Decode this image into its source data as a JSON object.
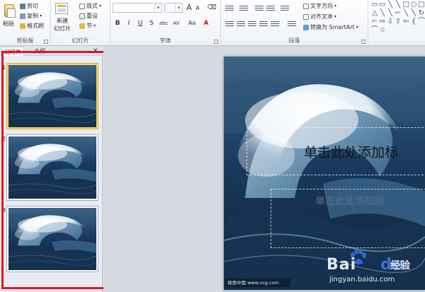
{
  "ribbon": {
    "clipboard": {
      "paste_label": "粘贴",
      "cut_label": "剪切",
      "copy_label": "复制",
      "format_painter_label": "格式刷",
      "group_label": "剪贴板"
    },
    "slides": {
      "new_slide_label_line1": "新建",
      "new_slide_label_line2": "幻灯片",
      "layout_label": "版式",
      "reset_label": "重设",
      "section_label": "节",
      "group_label": "幻灯片"
    },
    "font": {
      "grow_label": "A",
      "shrink_label": "A",
      "bold": "B",
      "italic": "I",
      "underline": "U",
      "strike": "S",
      "shadow": "abc",
      "spacing": "AV",
      "case": "Aa",
      "color": "A",
      "group_label": "字体"
    },
    "paragraph": {
      "text_direction_label": "文字方向",
      "align_text_label": "对齐文本",
      "smartart_label": "转换为 SmartArt",
      "group_label": "段落"
    },
    "drawing": {
      "shape_glyphs": [
        "▭",
        "▭",
        "╲",
        "╲",
        "□",
        "○",
        "□",
        "△",
        "╲",
        "╲",
        "⌐",
        "╲",
        "╲",
        "↻",
        "⌐",
        "⇨",
        "⇩",
        "⇧",
        "⇦",
        "{",
        "⌒",
        "⌒",
        "☆"
      ]
    }
  },
  "left_pane": {
    "tab_slides": "幻灯片",
    "tab_outline": "大纲",
    "close_glyph": "×",
    "slides": [
      {
        "number": "1",
        "selected": true
      },
      {
        "number": "2",
        "selected": false
      },
      {
        "number": "3",
        "selected": false
      }
    ]
  },
  "slide": {
    "title_placeholder": "单击此处添加标",
    "subtitle_placeholder": "单击此处添加副",
    "credit": "视觉中国 www.vcg.com"
  },
  "watermark": {
    "word_left": "Bai",
    "word_right": "du",
    "jingyan": "经验",
    "url": "jingyan.baidu.com"
  },
  "colors": {
    "highlight_red": "#e5141a",
    "selected_thumb": "#fbd86c",
    "wave_dark": "#1a3a5e",
    "wave_light": "#dfeaf3"
  }
}
